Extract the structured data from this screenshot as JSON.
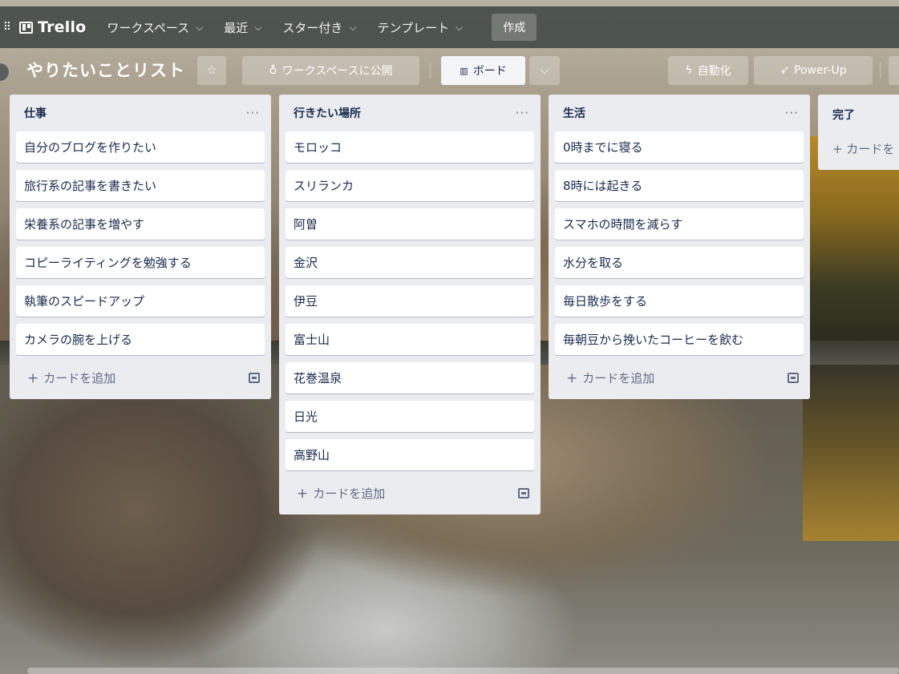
{
  "nav": {
    "brand": "Trello",
    "items": [
      {
        "label": "ワークスペース",
        "chev": "⌄"
      },
      {
        "label": "最近",
        "chev": "⌄"
      },
      {
        "label": "スター付き",
        "chev": "⌄"
      },
      {
        "label": "テンプレート",
        "chev": "⌄"
      }
    ],
    "create": "作成"
  },
  "board": {
    "title": "やりたいことリスト",
    "visibility": "ワークスペースに公開",
    "view": "ボード",
    "automation": "自動化",
    "powerup": "Power-Up"
  },
  "lists": [
    {
      "title": "仕事",
      "cards": [
        "自分のブログを作りたい",
        "旅行系の記事を書きたい",
        "栄養系の記事を増やす",
        "コピーライティングを勉強する",
        "執筆のスピードアップ",
        "カメラの腕を上げる"
      ],
      "add": "カードを追加"
    },
    {
      "title": "行きたい場所",
      "cards": [
        "モロッコ",
        "スリランカ",
        "阿曽",
        "金沢",
        "伊豆",
        "富士山",
        "花巻温泉",
        "日光",
        "高野山"
      ],
      "add": "カードを追加"
    },
    {
      "title": "生活",
      "cards": [
        "0時までに寝る",
        "8時には起きる",
        "スマホの時間を減らす",
        "水分を取る",
        "毎日散歩をする",
        "毎朝豆から挽いたコーヒーを飲む"
      ],
      "add": "カードを追加"
    },
    {
      "title": "完了",
      "cards": [],
      "add": "カードを"
    }
  ],
  "colors": {
    "nav_bg": "#444c46",
    "list_bg": "#ebecf0",
    "card_bg": "#ffffff",
    "text": "#172b4d",
    "muted": "#5e6c84"
  }
}
